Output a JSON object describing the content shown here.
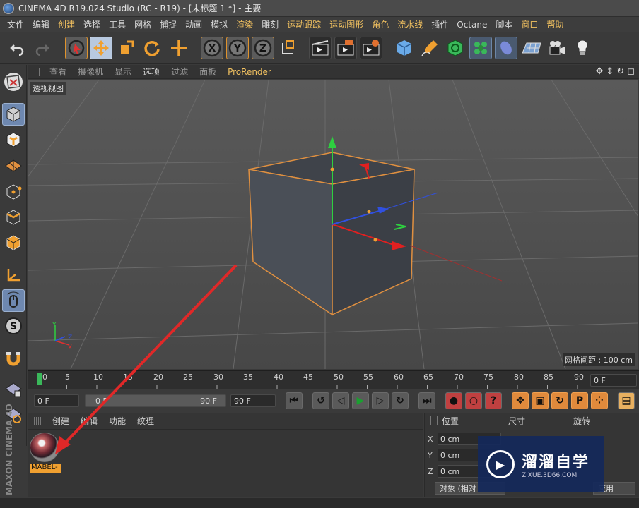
{
  "window": {
    "title": "CINEMA 4D R19.024 Studio (RC - R19) - [未标题 1 *] - 主要"
  },
  "menu": [
    "文件",
    "编辑",
    "创建",
    "选择",
    "工具",
    "网格",
    "捕捉",
    "动画",
    "模拟",
    "渲染",
    "雕刻",
    "运动跟踪",
    "运动图形",
    "角色",
    "流水线",
    "插件",
    "Octane",
    "脚本",
    "窗口",
    "帮助"
  ],
  "toolbar_icons": [
    "undo-icon",
    "redo-icon",
    "live-select-icon",
    "move-icon",
    "scale-icon",
    "rotate-icon",
    "last-tool-icon",
    "x-axis-icon",
    "y-axis-icon",
    "z-axis-icon",
    "coordinate-system-icon",
    "render-view-icon",
    "render-picture-viewer-icon",
    "render-settings-icon",
    "cube-icon",
    "pen-icon",
    "subdivision-icon",
    "cloner-icon",
    "deformer-icon",
    "floor-icon",
    "camera-icon",
    "light-icon"
  ],
  "viewport_menu": {
    "items": [
      "查看",
      "摄像机",
      "显示",
      "选项",
      "过滤",
      "面板",
      "ProRender"
    ]
  },
  "viewport": {
    "label": "透视视图",
    "grid_spacing": "网格间距 : 100 cm"
  },
  "timeline": {
    "ticks": [
      "0",
      "5",
      "10",
      "15",
      "20",
      "25",
      "30",
      "35",
      "40",
      "45",
      "50",
      "55",
      "60",
      "65",
      "70",
      "75",
      "80",
      "85",
      "90"
    ],
    "current_frame": "0 F"
  },
  "transport": {
    "start": "0 F",
    "range_start": "0 F",
    "range_end": "90 F",
    "end": "90 F"
  },
  "material_panel": {
    "tabs": [
      "创建",
      "编辑",
      "功能",
      "纹理"
    ],
    "materials": [
      {
        "name": "MABEL-"
      }
    ]
  },
  "attributes": {
    "headers": [
      "位置",
      "尺寸",
      "旋转"
    ],
    "rows": [
      {
        "axis": "X",
        "value": "0 cm"
      },
      {
        "axis": "Y",
        "value": "0 cm"
      },
      {
        "axis": "Z",
        "value": "0 cm"
      }
    ],
    "mode_button": "对象 (相对",
    "apply_button": "应用"
  },
  "branding": {
    "side": "MAXON CINEMA 4D"
  },
  "watermark": {
    "title": "溜溜自学",
    "url": "ZIXUE.3D66.COM"
  }
}
